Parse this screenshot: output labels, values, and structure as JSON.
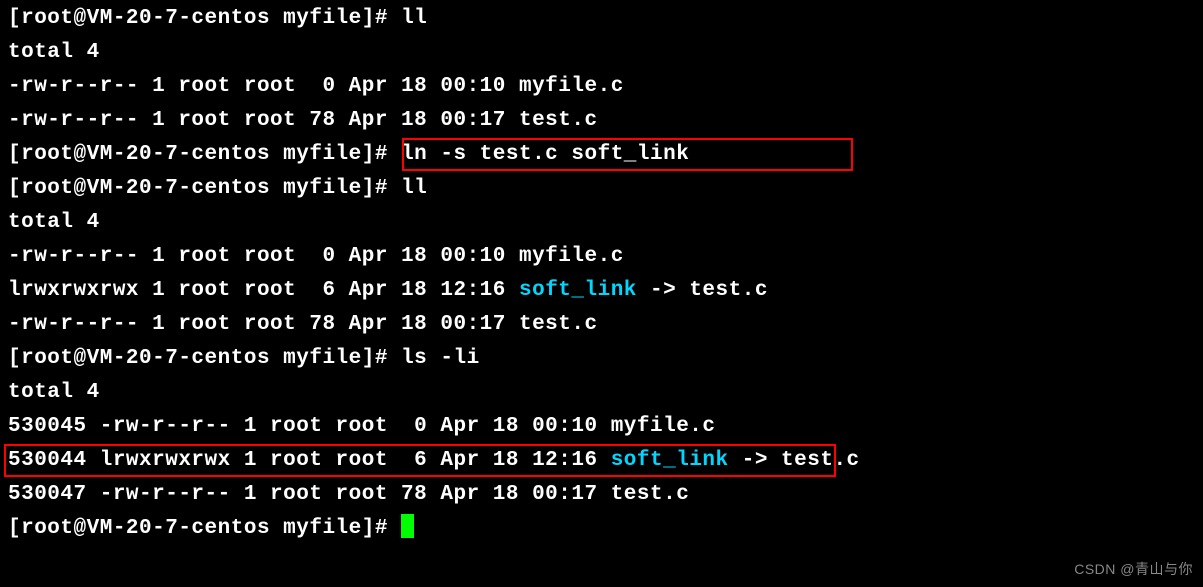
{
  "prompts": {
    "p0": "[root@VM-20-7-centos myfile]# ",
    "p1": "[root@VM-20-7-centos myfile]# ",
    "p2": "[root@VM-20-7-centos myfile]# ",
    "p3": "[root@VM-20-7-centos myfile]# ",
    "p4": "[root@VM-20-7-centos myfile]# "
  },
  "commands": {
    "c0": "ll",
    "c1": "ln -s test.c soft_link",
    "c2": "ll",
    "c3": "ls -li"
  },
  "out1": {
    "total": "total 4",
    "l1": "-rw-r--r-- 1 root root  0 Apr 18 00:10 myfile.c",
    "l2": "-rw-r--r-- 1 root root 78 Apr 18 00:17 test.c"
  },
  "out2": {
    "total": "total 4",
    "l1": "-rw-r--r-- 1 root root  0 Apr 18 00:10 myfile.c",
    "l2a": "lrwxrwxrwx 1 root root  6 Apr 18 12:16 ",
    "l2b": "soft_link",
    "l2c": " -> test.c",
    "l3": "-rw-r--r-- 1 root root 78 Apr 18 00:17 test.c"
  },
  "out3": {
    "total": "total 4",
    "l1": "530045 -rw-r--r-- 1 root root  0 Apr 18 00:10 myfile.c",
    "l2a": "530044 lrwxrwxrwx 1 root root  6 Apr 18 12:16 ",
    "l2b": "soft_link",
    "l2c": " -> test.c",
    "l3": "530047 -rw-r--r-- 1 root root 78 Apr 18 00:17 test.c"
  },
  "watermark": "CSDN @青山与你"
}
